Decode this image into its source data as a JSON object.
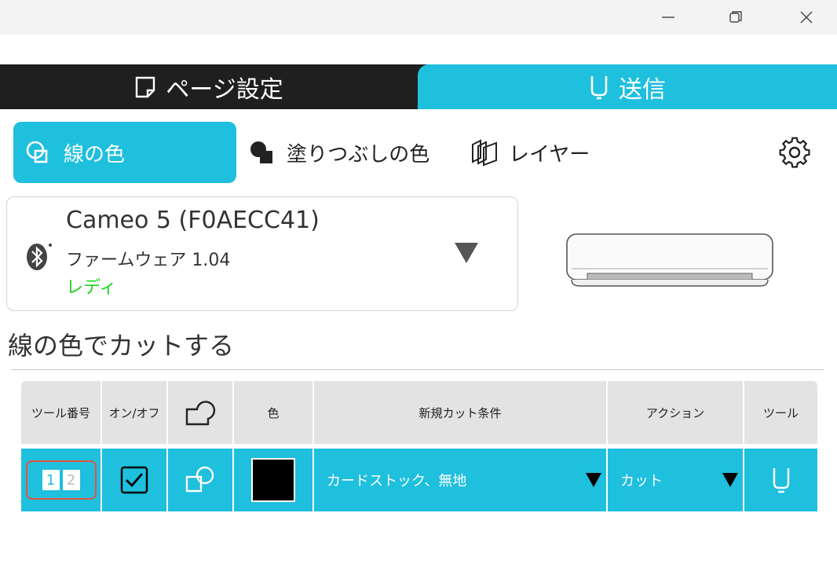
{
  "window": {
    "min_icon": "minimize-icon",
    "max_icon": "restore-icon",
    "close_icon": "close-icon"
  },
  "top_tabs": {
    "page_setup": "ページ設定",
    "send": "送信"
  },
  "sub_tabs": {
    "line_color": "線の色",
    "fill_color": "塗りつぶしの色",
    "layer": "レイヤー"
  },
  "device": {
    "name": "Cameo 5 (F0AECC41)",
    "firmware": "ファームウェア 1.04",
    "status": "レディ",
    "status_color": "#1ed31e"
  },
  "section_title": "線の色でカットする",
  "table": {
    "headers": [
      "ツール番号",
      "オン/オフ",
      "",
      "色",
      "新規カット条件",
      "アクション",
      "ツール"
    ],
    "row": {
      "tool_numbers": [
        "1",
        "2"
      ],
      "enabled": true,
      "color": "#000000",
      "material": "カードストック、無地",
      "action": "カット"
    }
  },
  "colors": {
    "accent": "#1fbfde",
    "topbar": "#1f1f1f",
    "header_bg": "#e3e3e3"
  }
}
